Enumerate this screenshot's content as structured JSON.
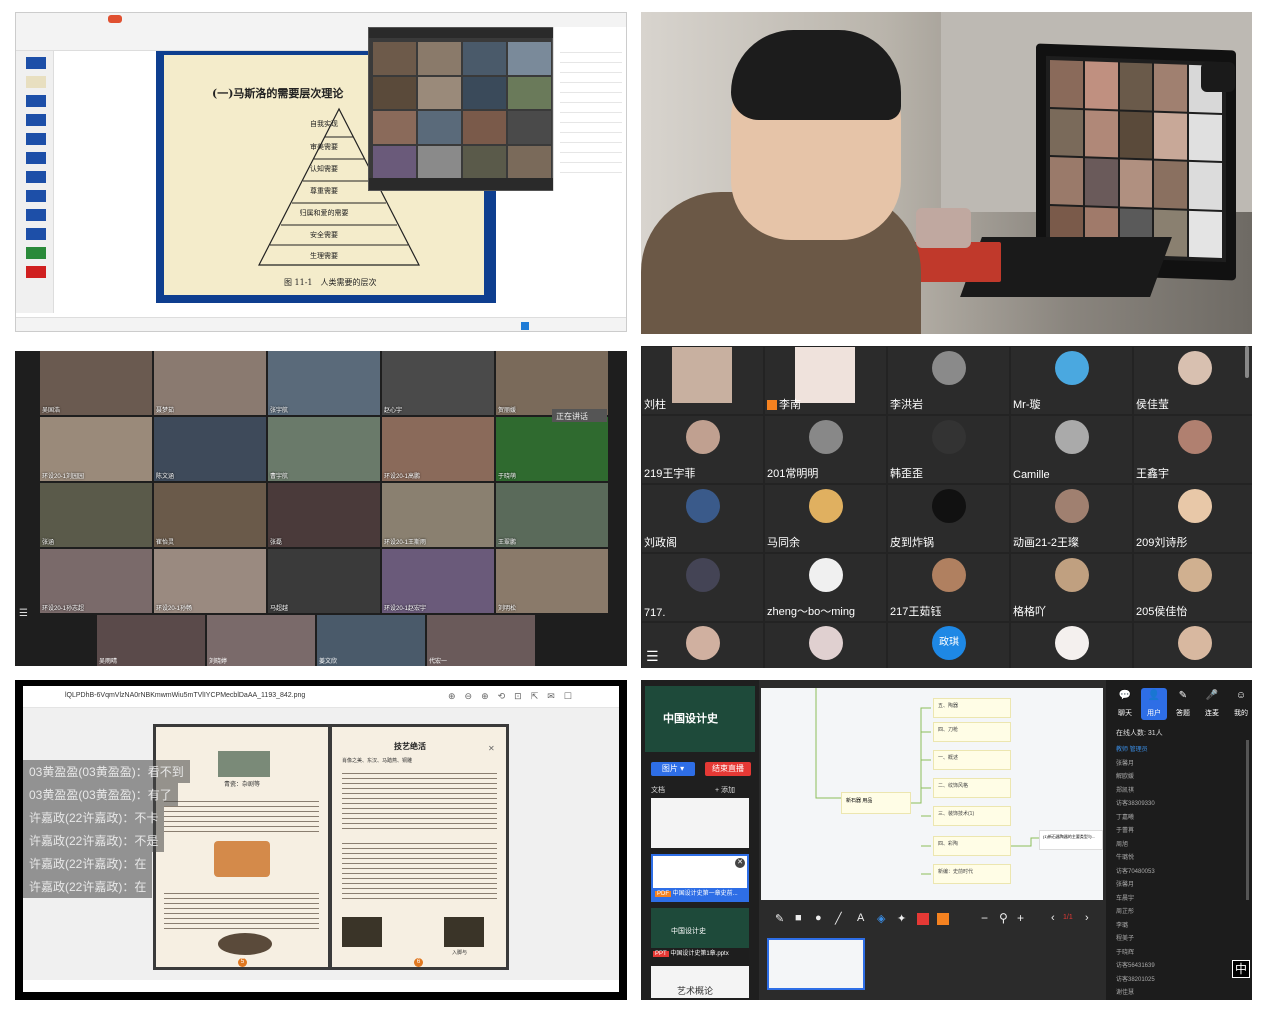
{
  "panel1": {
    "slide_title": "(一)马斯洛的需要层次理论",
    "pyramid_levels": [
      "自我实现",
      "审美需要",
      "认知需要",
      "尊重需要",
      "归属和爱的需要",
      "安全需要",
      "生理需要"
    ],
    "figure_caption": "图 11-1　人类需要的层次"
  },
  "panel3": {
    "names": [
      "吴国浩",
      "聂梦茹",
      "张宇航",
      "赵心宇",
      "贺丽媛",
      "环设20-1刘园园",
      "陈文涵",
      "曹宇航",
      "环设20-1高鹏",
      "于晓萌",
      "张涵",
      "崔怡灵",
      "张磊",
      "环设20-1王斯雨",
      "王翠鹏",
      "环设20-1孙志超",
      "环设20-1孙畅",
      "马超越",
      "环设20-1赵宏宇",
      "刘明松",
      "吴雨晴",
      "刘晓婷",
      "姜文欣",
      "代宏一"
    ],
    "speaking_label": "正在讲话"
  },
  "panel4": {
    "names": [
      "刘柱",
      "李南",
      "李洪岩",
      "Mr-璇",
      "侯佳莹",
      "219王宇菲",
      "201常明明",
      "韩歪歪",
      "Camille",
      "王鑫宇",
      "刘政阁",
      "马同余",
      "皮到炸锅",
      "动画21-2王璨",
      "209刘诗彤",
      "717.",
      "zheng～bo～ming",
      "217王茹钰",
      "格格吖",
      "205侯佳怡"
    ],
    "extra_avatar_label": "政琪",
    "guangming_label": "光明"
  },
  "panel5": {
    "filename": "lQLPDhB-6VqmVlzNA0rNBKmwmWiu5mTVlIYCPMecblDaAA_1193_842.png",
    "chat": [
      "03黄盈盈(03黄盈盈)：看不到",
      "03黄盈盈(03黄盈盈)：有了",
      "许嘉政(22许嘉政)：不卡",
      "许嘉政(22许嘉政)：不是",
      "许嘉政(22许嘉政)：在",
      "许嘉政(22许嘉政)：在"
    ],
    "page_title": "技艺绝活",
    "page_subtitle": "肖像之美、东汉、马踏燕、铜雕",
    "caption_left": "青瓷：杂剧等",
    "caption_right": "入脚与",
    "page_num_left": "5",
    "page_num_right": "6"
  },
  "panel6": {
    "course_title": "中国设计史",
    "btn_image": "图片 ▾",
    "btn_end": "结束直播",
    "doc_label": "文档",
    "add_label": "+ 添加",
    "file1": "中国设计史第一章史前...",
    "file2": "中国设计史第1章.pptx",
    "file1_type": "PDF",
    "file2_type": "PPT",
    "thumb_title": "中国设计史",
    "art_label": "艺术概论",
    "tabs": [
      "聊天",
      "用户",
      "答题",
      "连麦",
      "我的"
    ],
    "online": "在线人数: 31人",
    "users": [
      "教师 管理员",
      "张馨月",
      "解欧媛",
      "郑凯祺",
      "访客38309330",
      "丁嘉曦",
      "于蕾苒",
      "周旭",
      "牛璐悦",
      "访客70480053",
      "张馨月",
      "车晨宇",
      "周芷彤",
      "李璐",
      "程美子",
      "于晓辉",
      "访客56431639",
      "访客38201025",
      "谢佳慧"
    ],
    "mind_main": "新石器 用品",
    "mind_nodes": [
      "五、陶器",
      "四、刀枪",
      "一、概述",
      "二、纹饰风格",
      "三、装饰技术(1)",
      "四、彩陶",
      "新编：史前时代"
    ],
    "mind_right": "(1)新石器陶器的主要类型与...",
    "page_indicator": "1/1",
    "ime": "中"
  }
}
